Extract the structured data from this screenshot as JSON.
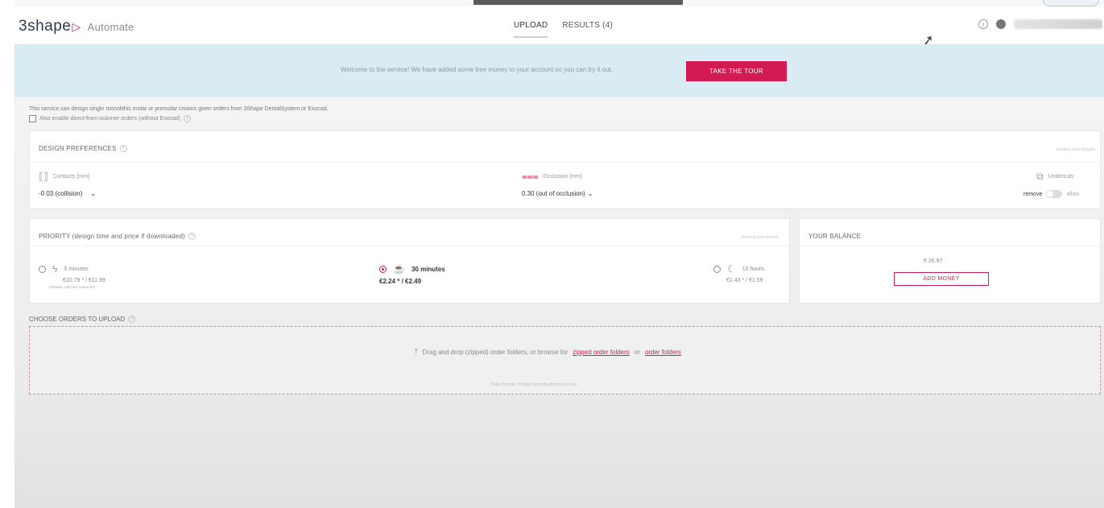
{
  "app": {
    "brand": "3shape",
    "product": "Automate",
    "brand_color": "#d41a52"
  },
  "header": {
    "tabs": [
      {
        "label": "UPLOAD",
        "active": true
      },
      {
        "label": "RESULTS (4)",
        "active": false
      }
    ],
    "info_icon": "info-circle-icon",
    "user_icon": "user-avatar-icon"
  },
  "banner": {
    "text": "Welcome to the service! We have added some free money to your account so you can try it out.",
    "button_label": "TAKE THE TOUR"
  },
  "intro": {
    "description": "This service can design single monolithic molar or premolar crowns given orders from 3Shape DentalSystem or Exocad.",
    "scanner_checkbox_label": "Also enable direct-from-scanner orders (without Exocad)",
    "scanner_checked": false
  },
  "design_preferences": {
    "title": "DESIGN PREFERENCES",
    "defaults_note": "showing your defaults",
    "contacts": {
      "label": "Contacts [mm]",
      "value": "-0.03 (collision)",
      "icon": "contacts-icon"
    },
    "occlusion": {
      "label": "Occlusion [mm]",
      "value": "0.30 (out of occlusion)",
      "icon": "occlusion-icon"
    },
    "undercuts": {
      "label": "Undercuts",
      "left_option": "remove",
      "right_option": "allow",
      "icon": "undercuts-icon"
    }
  },
  "priority": {
    "title": "PRIORITY (design time and price if downloaded)",
    "defaults_note": "showing your default",
    "options": [
      {
        "time": "5 minutes",
        "price": "€10.79 * / €11.99",
        "note": "* 3Shape LabCare customers",
        "selected": false,
        "icon": "lightning-icon"
      },
      {
        "time": "30 minutes",
        "price": "€2.24 * / €2.49",
        "selected": true,
        "icon": "coffee-cup-icon"
      },
      {
        "time": "10 hours",
        "price": "€1.43 * / €1.59",
        "selected": false,
        "icon": "moon-icon"
      }
    ]
  },
  "balance": {
    "title": "YOUR BALANCE",
    "amount": "€ 26.97",
    "button_label": "ADD MONEY"
  },
  "orders": {
    "title": "CHOOSE ORDERS TO UPLOAD",
    "drop_text": "Drag and drop (zipped) order folders, or browse for",
    "link_zipped": "zipped order folders",
    "or_text": "or",
    "link_folders": "order folders",
    "formats_note": "Order formats: 3Shape DentalSystem or Exocad",
    "upload_icon": "upload-icon"
  }
}
